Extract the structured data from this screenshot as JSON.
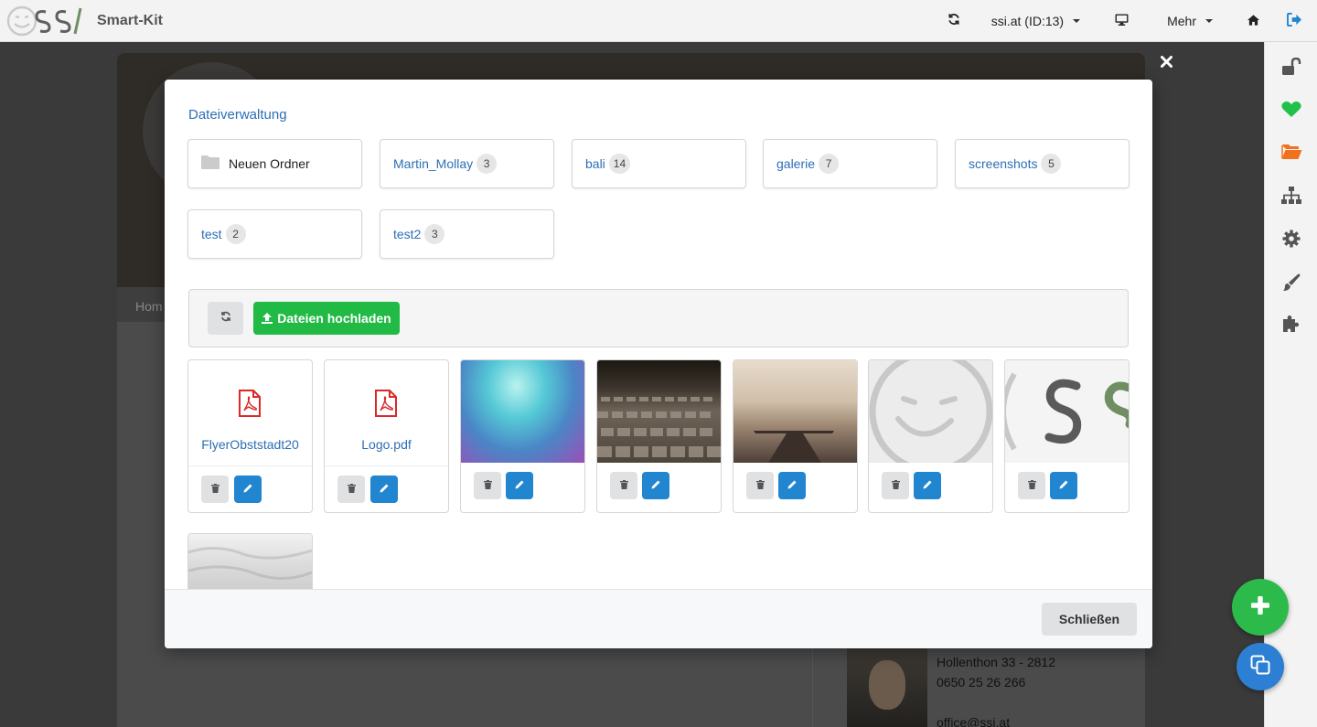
{
  "header": {
    "brand": "Smart-Kit",
    "account": "ssi.at (ID:13)",
    "more": "Mehr"
  },
  "background": {
    "nav_text": "Hom",
    "contact": {
      "address": "Hollenthon 33 - 2812",
      "phone": "0650 25 26 266",
      "email": "office@ssi.at"
    }
  },
  "modal": {
    "title": "Dateiverwaltung",
    "new_folder": "Neuen Ordner",
    "folders": [
      {
        "name": "Martin_Mollay",
        "count": "3"
      },
      {
        "name": "bali",
        "count": "14"
      },
      {
        "name": "galerie",
        "count": "7"
      },
      {
        "name": "screenshots",
        "count": "5"
      },
      {
        "name": "test",
        "count": "2"
      },
      {
        "name": "test2",
        "count": "3"
      }
    ],
    "upload_label": "Dateien hochladen",
    "files": [
      {
        "type": "pdf",
        "name": "FlyerObststadt20"
      },
      {
        "type": "pdf",
        "name": "Logo.pdf"
      },
      {
        "type": "image"
      },
      {
        "type": "image"
      },
      {
        "type": "image"
      },
      {
        "type": "image"
      },
      {
        "type": "image"
      },
      {
        "type": "image"
      }
    ],
    "close_label": "Schließen"
  },
  "colors": {
    "link_blue": "#2c6fb4",
    "upload_green": "#21ba45",
    "edit_blue": "#2185d0",
    "fab_green": "#2cbb4a",
    "fab_blue": "#2c7fd2",
    "heart_green": "#21c04b",
    "folder_orange": "#f2711c",
    "pdf_red": "#db2828"
  },
  "icons": {
    "top": [
      "refresh-icon",
      "desktop-icon",
      "home-icon",
      "logout-icon"
    ],
    "sidebar": [
      "unlock-icon",
      "heart-icon",
      "folder-open-icon",
      "sitemap-icon",
      "gear-icon",
      "paint-brush-icon",
      "puzzle-icon"
    ]
  }
}
